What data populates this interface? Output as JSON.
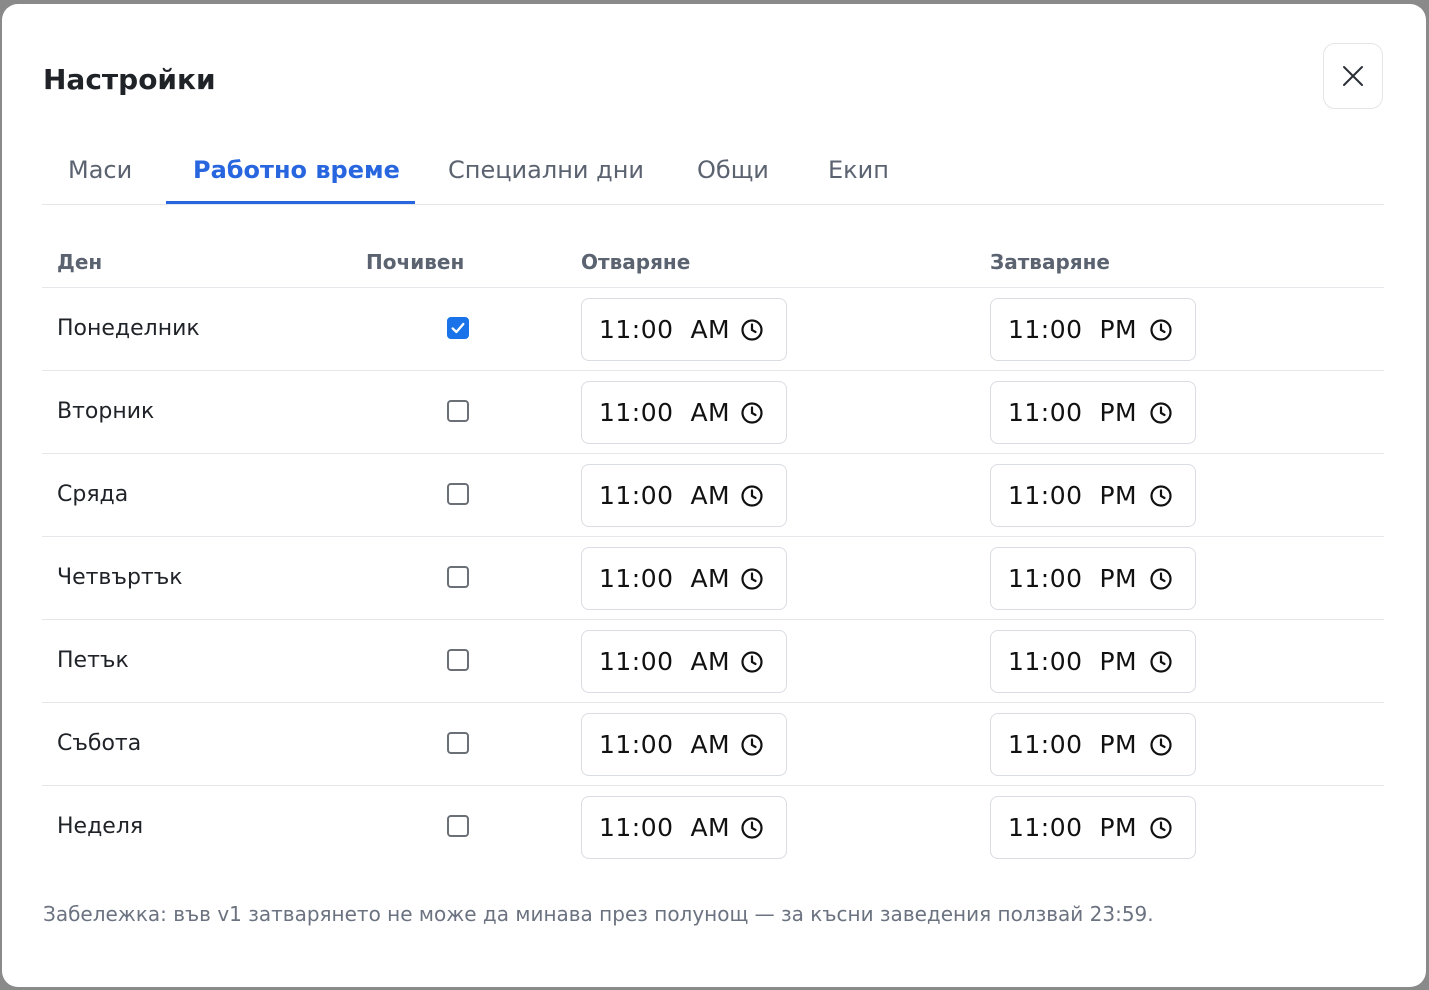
{
  "dialog": {
    "title": "Настройки",
    "close_icon": "close-icon"
  },
  "tabs": [
    {
      "label": "Маси",
      "active": false
    },
    {
      "label": "Работно време",
      "active": true
    },
    {
      "label": "Специални дни",
      "active": false
    },
    {
      "label": "Общи",
      "active": false
    },
    {
      "label": "Екип",
      "active": false
    }
  ],
  "table": {
    "headers": {
      "day": "Ден",
      "off": "Почивен",
      "open": "Отваряне",
      "close": "Затваряне"
    },
    "rows": [
      {
        "day": "Понеделник",
        "off": true,
        "open": "11:00  AM",
        "close": "11:00  PM"
      },
      {
        "day": "Вторник",
        "off": false,
        "open": "11:00  AM",
        "close": "11:00  PM"
      },
      {
        "day": "Сряда",
        "off": false,
        "open": "11:00  AM",
        "close": "11:00  PM"
      },
      {
        "day": "Четвъртък",
        "off": false,
        "open": "11:00  AM",
        "close": "11:00  PM"
      },
      {
        "day": "Петък",
        "off": false,
        "open": "11:00  AM",
        "close": "11:00  PM"
      },
      {
        "day": "Събота",
        "off": false,
        "open": "11:00  AM",
        "close": "11:00  PM"
      },
      {
        "day": "Неделя",
        "off": false,
        "open": "11:00  AM",
        "close": "11:00  PM"
      }
    ],
    "time_icon": "clock-icon"
  },
  "note": "Забележка: във v1 затварянето не може да минава през полунощ — за късни заведения ползвай 23:59.",
  "colors": {
    "accent": "#2866e0",
    "checkbox_checked": "#1a73e8",
    "muted_text": "#5b6370",
    "border": "#e5e7eb"
  }
}
